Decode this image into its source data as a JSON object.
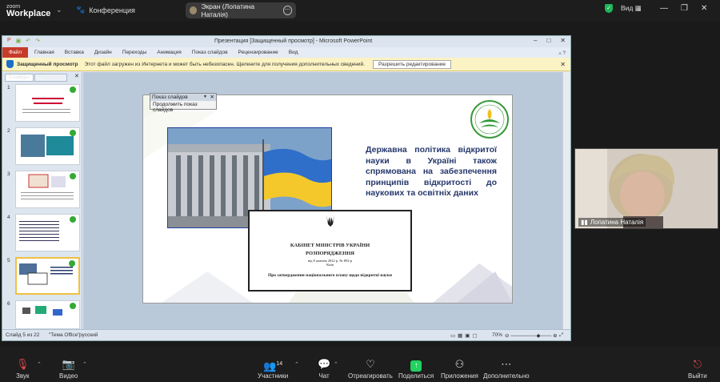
{
  "zoom": {
    "logo_small": "zoom",
    "logo_big": "Workplace",
    "conference_label": "Конференция",
    "screen_share_label": "Экран (Лопатина Наталія)",
    "view_label": "Вид"
  },
  "ppt": {
    "title": "Презентация [Защищенный просмотр] - Microsoft PowerPoint",
    "tabs": [
      "Файл",
      "Главная",
      "Вставка",
      "Дизайн",
      "Переходы",
      "Анимация",
      "Показ слайдов",
      "Рецензирование",
      "Вид"
    ],
    "security": {
      "title": "Защищенный просмотр",
      "message": "Этот файл загружен из Интернета и может быть небезопасен. Щелкните для получения дополнительных сведений.",
      "button": "Разрешить редактирование"
    },
    "panel_tabs": [
      "Слайды",
      "Структура"
    ],
    "thumb_numbers": [
      "1",
      "2",
      "3",
      "4",
      "5",
      "6"
    ],
    "popup": {
      "title": "Показ слайдов",
      "item": "Продолжить показ слайдов"
    },
    "slide": {
      "title": "Державна політика відкритої науки в Україні також спрямована на забезпечення принципів відкритості до наукових та освітніх даних",
      "doc_line1": "КАБІНЕТ МІНІСТРІВ УКРАЇНИ",
      "doc_line2": "РОЗПОРЯДЖЕННЯ",
      "doc_line3": "від 8 жовтня 2022 р. № 892-р",
      "doc_line4": "Київ",
      "doc_line5": "Про затвердження національного плану щодо відкритої науки"
    },
    "status": {
      "slide": "Слайд 5 из 22",
      "theme": "\"Тема Office\"",
      "lang": "русский",
      "zoom": "70%"
    }
  },
  "video": {
    "name": "Лопатина Наталія"
  },
  "toolbar": {
    "mute": "Звук",
    "video": "Видео",
    "participants": "Участники",
    "participants_count": "14",
    "chat": "Чат",
    "react": "Отреагировать",
    "share": "Поделиться",
    "apps": "Приложения",
    "more": "Дополнительно",
    "leave": "Выйти"
  },
  "colors": {
    "share_green": "#23d160",
    "ppt_file_red": "#c73b2a",
    "slide_title": "#26386c",
    "leave_red": "#e5484d"
  }
}
